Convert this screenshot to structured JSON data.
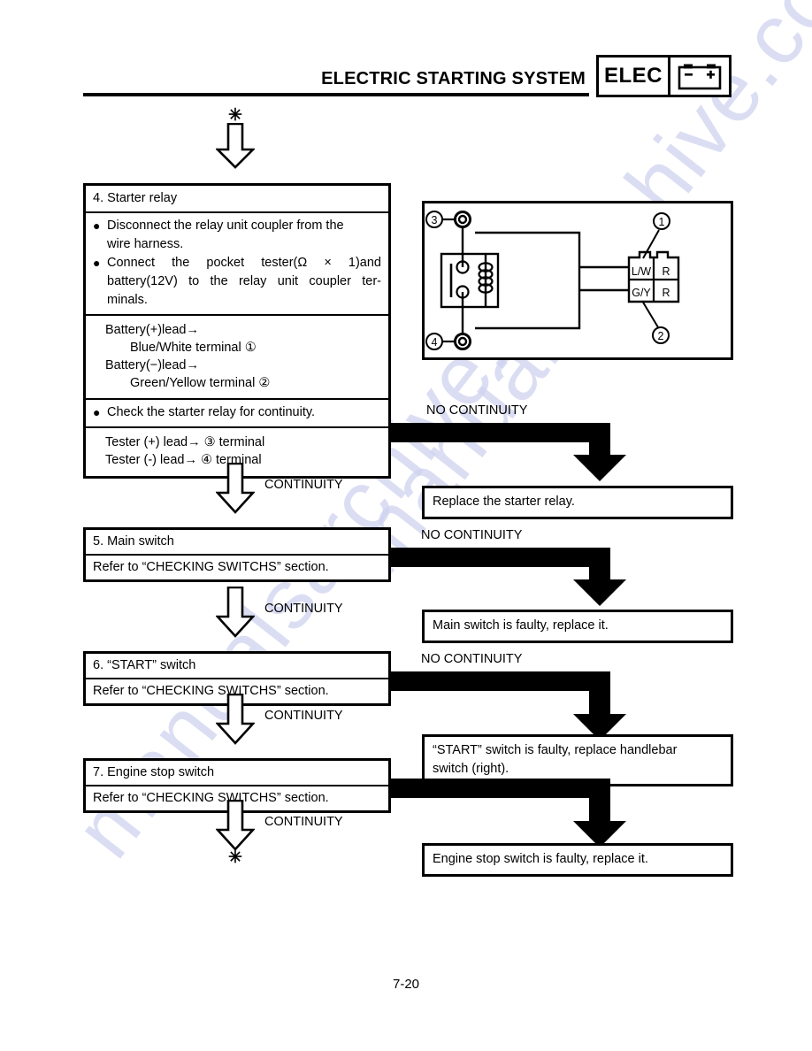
{
  "header": {
    "title": "ELECTRIC STARTING SYSTEM",
    "badge_label": "ELEC",
    "battery_minus": "−",
    "battery_plus": "+"
  },
  "markers": {
    "top_asterisk": "✳",
    "bottom_asterisk": "✳"
  },
  "branch_labels": {
    "continuity": "CONTINUITY",
    "no_continuity": "NO CONTINUITY"
  },
  "steps": [
    {
      "id": "step4",
      "title": "4. Starter relay",
      "bullets": [
        "Disconnect the relay unit coupler from the wire harness.",
        "Connect the pocket tester(Ω × 1)and battery(12V) to the relay unit coupler ter-minals."
      ],
      "bullet_lines": [
        [
          "Disconnect the relay unit coupler from the",
          "wire harness."
        ],
        [
          "Connect  the  pocket  tester(Ω × 1)and",
          "battery(12V) to the relay unit coupler ter-",
          "minals."
        ]
      ],
      "connections": [
        "Battery(+)lead→",
        "Blue/White terminal ①",
        "Battery(−)lead→",
        "Green/Yellow terminal ②"
      ],
      "check_bullet": "Check the starter relay for continuity.",
      "tester_lines": [
        "Tester (+) lead→ ③  terminal",
        "Tester (-) lead→ ④  terminal"
      ]
    },
    {
      "id": "step5",
      "title": "5. Main switch",
      "reference": "Refer to “CHECKING SWITCHS” section."
    },
    {
      "id": "step6",
      "title": "6. “START” switch",
      "reference": "Refer to “CHECKING SWITCHS” section."
    },
    {
      "id": "step7",
      "title": "7. Engine stop switch",
      "reference": "Refer to “CHECKING SWITCHS” section."
    }
  ],
  "results": [
    {
      "id": "result4",
      "text": "Replace the starter relay."
    },
    {
      "id": "result5",
      "text": "Main switch is faulty, replace it."
    },
    {
      "id": "result6_line1",
      "text": "“START” switch is faulty, replace handlebar"
    },
    {
      "id": "result6_line2",
      "text": "switch (right)."
    },
    {
      "id": "result7",
      "text": "Engine stop switch is faulty, replace it."
    }
  ],
  "relay_diagram": {
    "terminal_3": "③",
    "terminal_4": "④",
    "callout_1": "①",
    "callout_2": "②",
    "coupler_cells": [
      [
        "L/W",
        "R"
      ],
      [
        "G/Y",
        "R"
      ]
    ]
  },
  "watermark": {
    "text_a": "manualsarchive.com",
    "text_b": "manualsarchive.com",
    "color": "#cfd3ef"
  },
  "footer": {
    "page_number": "7-20"
  }
}
